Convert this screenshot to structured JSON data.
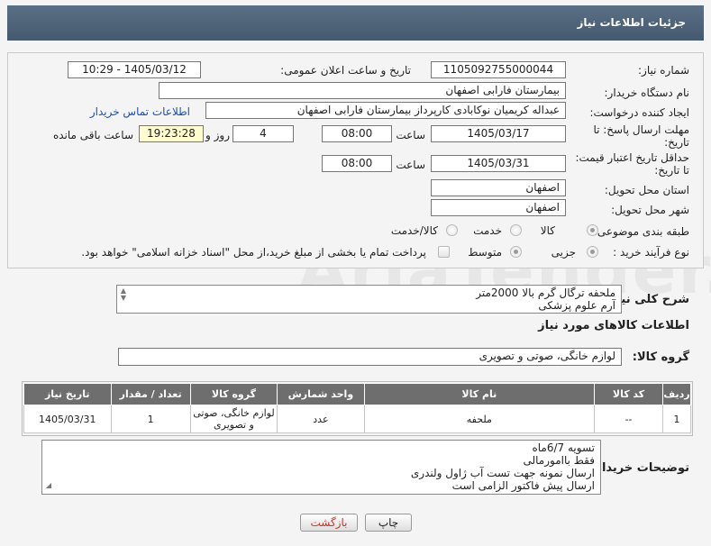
{
  "title": "جزئیات اطلاعات نیاز",
  "fields": {
    "need_number_label": "شماره نیاز:",
    "need_number": "1105092755000044",
    "announce_label": "تاریخ و ساعت اعلان عمومی:",
    "announce_value": "1405/03/12 - 10:29",
    "buyer_label": "نام دستگاه خریدار:",
    "buyer_value": "بیمارستان فارابی اصفهان",
    "creator_label": "ایجاد کننده درخواست:",
    "creator_value": "عبداله کریمیان نوکابادی کارپرداز بیمارستان فارابی اصفهان",
    "contact_link": "اطلاعات تماس خریدار",
    "deadline_label_1": "مهلت ارسال پاسخ: تا",
    "deadline_label_2": "تاریخ:",
    "deadline_date": "1405/03/17",
    "time_label": "ساعت",
    "deadline_time": "08:00",
    "days_value": "4",
    "days_label": "روز و",
    "remaining_time": "19:23:28",
    "remaining_label": "ساعت باقی مانده",
    "validity_label_1": "حداقل تاریخ اعتبار قیمت:",
    "validity_label_2": "تا تاریخ:",
    "validity_date": "1405/03/31",
    "validity_time_label": "ساعت",
    "validity_time": "08:00",
    "province_label": "استان محل تحویل:",
    "province_value": "اصفهان",
    "city_label": "شهر محل تحویل:",
    "city_value": "اصفهان",
    "category_label": "طبقه بندی موضوعی:",
    "category_options": [
      "کالا",
      "خدمت",
      "کالا/خدمت"
    ],
    "process_label": "نوع فرآیند خرید :",
    "process_options": [
      "جزیی",
      "متوسط"
    ],
    "payment_note": "پرداخت تمام یا بخشی از مبلغ خرید،از محل \"اسناد خزانه اسلامی\" خواهد بود."
  },
  "description": {
    "label": "شرح کلی نیاز:",
    "lines": [
      "ملحفه ترگال گرم بالا 2000متر",
      "آرم علوم پزشکی"
    ]
  },
  "goods_section_title": "اطلاعات کالاهای مورد نیاز",
  "goods_group": {
    "label": "گروه کالا:",
    "value": "لوازم خانگی، صوتی و تصویری"
  },
  "table": {
    "headers": [
      "ردیف",
      "کد کالا",
      "نام کالا",
      "واحد شمارش",
      "گروه کالا",
      "تعداد / مقدار",
      "تاریخ نیاز"
    ],
    "rows": [
      [
        "1",
        "--",
        "ملحفه",
        "عدد",
        "لوازم خانگی، صوتی و تصویری",
        "1",
        "1405/03/31"
      ]
    ]
  },
  "buyer_notes": {
    "label": "توضیحات خریدار:",
    "lines": [
      "تسویه 6/7ماه",
      "فقط باامورمالی",
      "ارسال نمونه جهت تست آب ژاول ولندری",
      "ارسال پیش فاکتور الزامی است"
    ]
  },
  "buttons": {
    "print": "چاپ",
    "back": "بازگشت"
  },
  "watermark": "AriaTender.net"
}
